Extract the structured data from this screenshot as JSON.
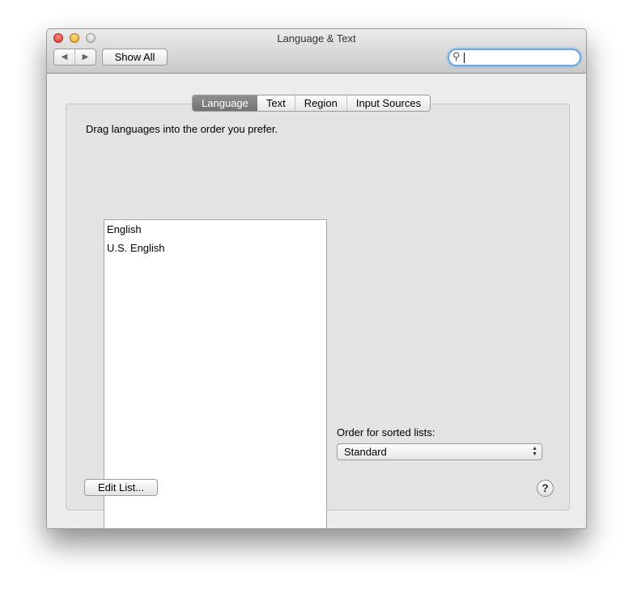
{
  "window": {
    "title": "Language & Text"
  },
  "toolbar": {
    "back": "◀",
    "forward": "▶",
    "show_all": "Show All",
    "search_value": "",
    "search_icon": "⚲"
  },
  "tabs": [
    {
      "label": "Language",
      "selected": true
    },
    {
      "label": "Text"
    },
    {
      "label": "Region"
    },
    {
      "label": "Input Sources"
    }
  ],
  "language": {
    "instruction": "Drag languages into the order you prefer.",
    "items": [
      "English",
      "U.S. English"
    ],
    "edit_list": "Edit List..."
  },
  "sort": {
    "label": "Order for sorted lists:",
    "value": "Standard"
  },
  "help": "?"
}
